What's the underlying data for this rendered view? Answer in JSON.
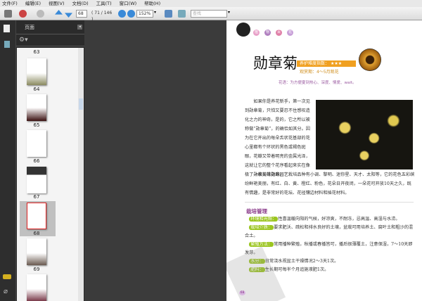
{
  "menu": [
    "文件(F)",
    "编辑(E)",
    "视图(V)",
    "文档(D)",
    "工具(T)",
    "窗口(W)",
    "帮助(H)"
  ],
  "toolbar": {
    "page_input": "68",
    "page_count": "( 71 / 146 )",
    "zoom": "152%",
    "search_placeholder": "查找"
  },
  "sidebar": {
    "panel_title": "页面",
    "thumbnails": [
      {
        "label": "63"
      },
      {
        "label": "64"
      },
      {
        "label": "65"
      },
      {
        "label": "66"
      },
      {
        "label": "67"
      },
      {
        "label": "68",
        "selected": true
      },
      {
        "label": "69"
      }
    ]
  },
  "document": {
    "header_circles": [
      "植",
      "物",
      "百",
      "花"
    ],
    "title": "勋章菊",
    "difficulty_label": "养护难度指数：",
    "difficulty_stars": "★★★",
    "viewing_period": "观赏期：4～5月观花",
    "flower_language": "花语：为方便夏到热心、深度、情爱、wait。",
    "para1": "如果你是养花新手，第一次见到勋章菊，只怕又要忍不住感叹造化之力的神奇。是的，它之所以被称做“勋章菊”，的确恰如其分。因为在它开出的每朵舌状花基部的花心里都有个环状的黑色或褐色斑眼，花瓣又带着明亮的金属光泽，这就让它的整个花序看起来实在像极了一枚英雄勋章。",
    "para2": "勋章菊常见的园艺栽培品种有小调、黎明、迷你星、天才、太阳等，它的花色五彩缤纷鲜艳美丽，有红、白、黄、橙红、粉色，花朵日开夜闭，一朵花可开放10天之久，既有情趣，是非常好的花坛、花径镶边材料和插花材料。",
    "care_title": "栽培管理",
    "care": [
      {
        "tag": "环境和光照：",
        "text": "性喜温暖向阳的气候，好凉爽，不耐冻，忌高温、高湿与水涝。"
      },
      {
        "tag": "栽培介质：",
        "text": "要求肥沃、疏松和排水良好的土壤，盆栽可用培养土、腐叶土和粗沙的混合土。"
      },
      {
        "tag": "繁殖方法：",
        "text": "常用播种繁殖，秋播或春播皆可，播后很薄覆土，注意保湿，7～10天即发芽。"
      },
      {
        "tag": "水分：",
        "text": "日常浇水视盆土干燥情况2～3天1次。"
      },
      {
        "tag": "肥料：",
        "text": "生长期可每半个月追施液肥1次。"
      }
    ],
    "page_number": "68"
  },
  "colors": {
    "accent_green": "#9bc520",
    "orange": "#f0a020",
    "purple": "#8a3a8a"
  }
}
